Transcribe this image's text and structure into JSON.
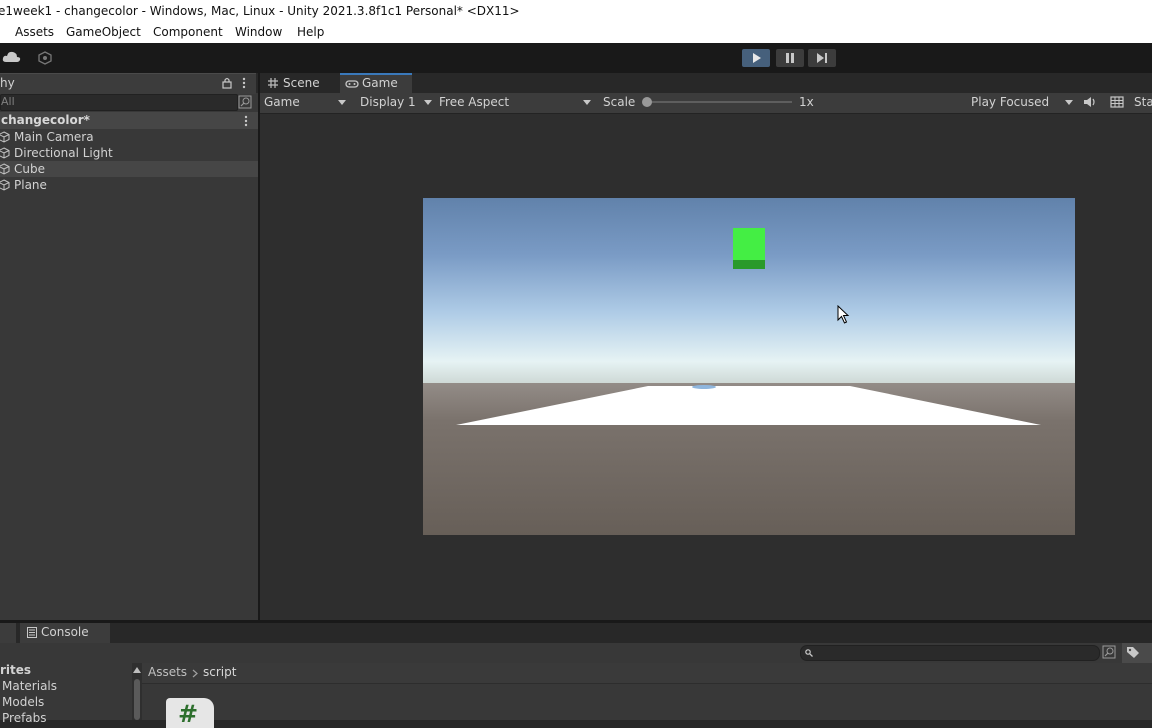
{
  "window": {
    "title": "e1week1 - changecolor - Windows, Mac, Linux - Unity 2021.3.8f1c1 Personal* <DX11>"
  },
  "menu": [
    "Assets",
    "GameObject",
    "Component",
    "Window",
    "Help"
  ],
  "toolbar": {
    "play_active": true
  },
  "hierarchy": {
    "tab_label": "hy",
    "search_placeholder": "All",
    "scene_name": "changecolor*",
    "items": [
      {
        "label": "Main Camera"
      },
      {
        "label": "Directional Light"
      },
      {
        "label": "Cube",
        "selected": true
      },
      {
        "label": "Plane"
      }
    ]
  },
  "game_view": {
    "tabs": [
      "Scene",
      "Game"
    ],
    "active_tab": "Game",
    "view_mode": "Game",
    "display": "Display 1",
    "aspect": "Free Aspect",
    "scale_label": "Scale",
    "scale_value": "1x",
    "play_mode": "Play Focused",
    "stats_label": "Sta",
    "cube_color": "#44ee44"
  },
  "bottom": {
    "console_label": "Console",
    "left_header": "rites",
    "folders": [
      "Materials",
      "Models",
      "Prefabs"
    ],
    "breadcrumb": [
      "Assets",
      "script"
    ],
    "script_glyph": "#"
  },
  "colors": {
    "accent": "#3a79bb",
    "play_active": "#46607c",
    "editor_bg": "#383838"
  }
}
